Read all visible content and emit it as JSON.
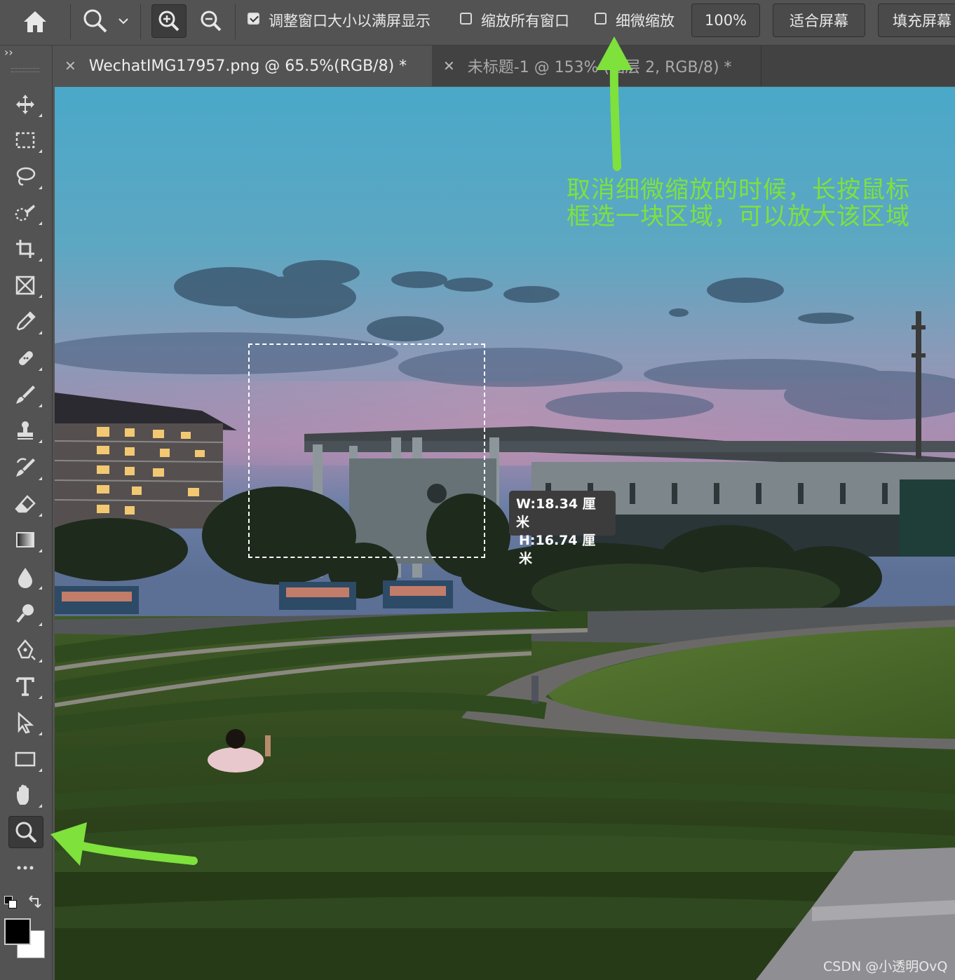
{
  "options_bar": {
    "home_icon": "home-icon",
    "zoom_preset_icon": "zoom-tool-icon",
    "zoom_in_icon": "zoom-in-icon",
    "zoom_out_icon": "zoom-out-icon",
    "resize_windows_label": "调整窗口大小以满屏显示",
    "resize_windows_checked": true,
    "zoom_all_label": "缩放所有窗口",
    "zoom_all_checked": false,
    "scrubby_zoom_label": "细微缩放",
    "scrubby_zoom_checked": false,
    "btn_100": "100%",
    "btn_fit": "适合屏幕",
    "btn_fill": "填充屏幕"
  },
  "tabs": [
    {
      "label": "WechatIMG17957.png @ 65.5%(RGB/8) *",
      "active": true
    },
    {
      "label": "未标题-1 @ 153% (图层 2, RGB/8) *",
      "active": false
    }
  ],
  "panel_toggle": "››",
  "tools": [
    "move-tool-icon",
    "marquee-tool-icon",
    "lasso-tool-icon",
    "quick-select-tool-icon",
    "crop-tool-icon",
    "frame-tool-icon",
    "eyedropper-tool-icon",
    "healing-brush-tool-icon",
    "brush-tool-icon",
    "clone-stamp-tool-icon",
    "history-brush-tool-icon",
    "eraser-tool-icon",
    "gradient-tool-icon",
    "blur-tool-icon",
    "dodge-tool-icon",
    "pen-tool-icon",
    "type-tool-icon",
    "path-select-tool-icon",
    "rectangle-tool-icon",
    "hand-tool-icon",
    "zoom-tool-icon",
    "more-tools-icon"
  ],
  "canvas": {
    "annotation_line1": "取消细微缩放的时候，长按鼠标",
    "annotation_line2": "框选一块区域，可以放大该区域",
    "selection_w": "W:18.34 厘米",
    "selection_h": "H:16.74 厘米",
    "watermark": "CSDN @小透明OvQ"
  },
  "colors": {
    "ui_bg": "#535353",
    "annotation_green": "#7fe13c",
    "foreground": "#000000",
    "background": "#ffffff"
  }
}
